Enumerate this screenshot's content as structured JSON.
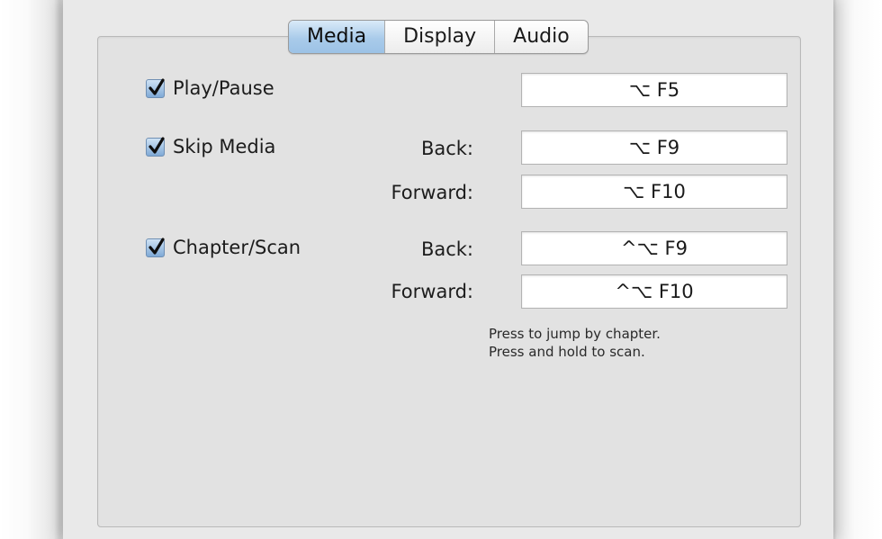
{
  "tabs": [
    {
      "label": "Media",
      "active": true
    },
    {
      "label": "Display",
      "active": false
    },
    {
      "label": "Audio",
      "active": false
    }
  ],
  "rows": {
    "play_pause": {
      "label": "Play/Pause",
      "checked": true,
      "shortcut": "⌥ F5"
    },
    "skip_media": {
      "label": "Skip Media",
      "checked": true,
      "back_label": "Back:",
      "back_shortcut": "⌥ F9",
      "forward_label": "Forward:",
      "forward_shortcut": "⌥ F10"
    },
    "chapter_scan": {
      "label": "Chapter/Scan",
      "checked": true,
      "back_label": "Back:",
      "back_shortcut": "^⌥ F9",
      "forward_label": "Forward:",
      "forward_shortcut": "^⌥ F10"
    }
  },
  "hint": {
    "line1": "Press to jump by chapter.",
    "line2": "Press and hold to scan."
  },
  "colors": {
    "active_tab": "#a9cbea",
    "checkbox": "#7fa9d6",
    "panel": "#e2e2e2"
  }
}
